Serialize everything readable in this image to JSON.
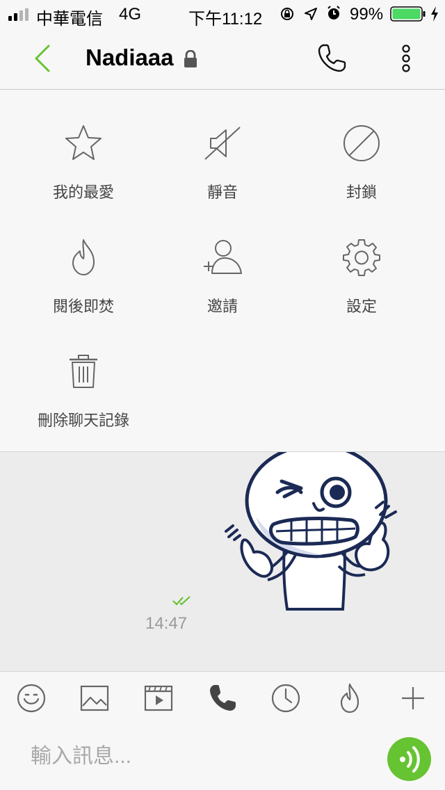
{
  "status": {
    "carrier": "中華電信",
    "network": "4G",
    "time": "下午11:12",
    "battery": "99%"
  },
  "header": {
    "title": "Nadiaaa"
  },
  "menu": {
    "items": [
      {
        "label": "我的最愛",
        "icon": "star-icon"
      },
      {
        "label": "靜音",
        "icon": "mute-icon"
      },
      {
        "label": "封鎖",
        "icon": "block-icon"
      },
      {
        "label": "閱後即焚",
        "icon": "flame-icon"
      },
      {
        "label": "邀請",
        "icon": "invite-icon"
      },
      {
        "label": "設定",
        "icon": "gear-icon"
      },
      {
        "label": "刪除聊天記錄",
        "icon": "trash-icon"
      }
    ]
  },
  "chat": {
    "message_time": "14:47",
    "read_status": "read"
  },
  "toolbar": {
    "icons": [
      "emoji-icon",
      "image-icon",
      "video-icon",
      "call-icon",
      "clock-icon",
      "flame-icon",
      "plus-icon"
    ]
  },
  "input": {
    "placeholder": "輸入訊息..."
  },
  "colors": {
    "accent": "#66c332",
    "background": "#f7f7f7",
    "chat_background": "#ececec"
  }
}
